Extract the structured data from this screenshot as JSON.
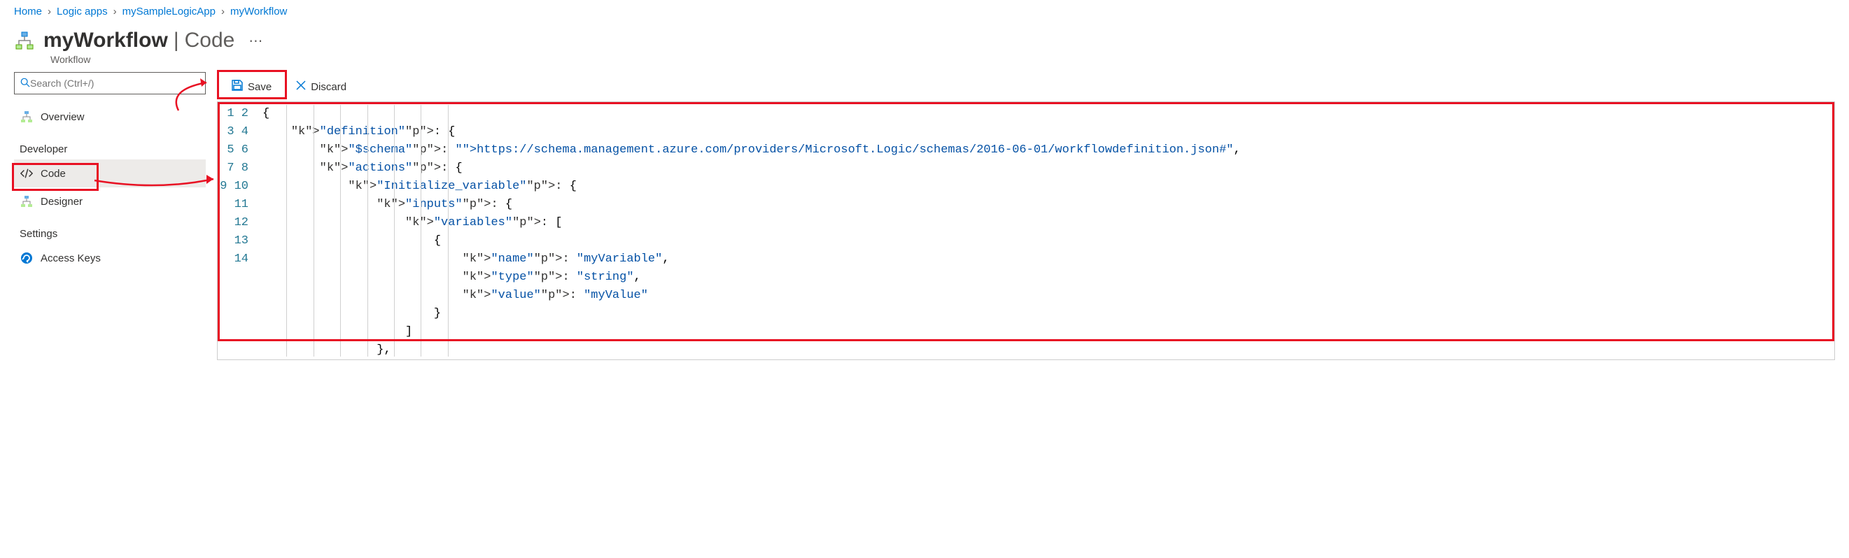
{
  "breadcrumb": [
    {
      "label": "Home"
    },
    {
      "label": "Logic apps"
    },
    {
      "label": "mySampleLogicApp"
    },
    {
      "label": "myWorkflow"
    }
  ],
  "header": {
    "title": "myWorkflow",
    "section": "Code",
    "subtitle": "Workflow"
  },
  "sidebar": {
    "search_placeholder": "Search (Ctrl+/)",
    "overview_label": "Overview",
    "developer_label": "Developer",
    "code_label": "Code",
    "designer_label": "Designer",
    "settings_label": "Settings",
    "access_keys_label": "Access Keys"
  },
  "toolbar": {
    "save_label": "Save",
    "discard_label": "Discard"
  },
  "editor": {
    "line_count": 14,
    "schema_url": "https://schema.management.azure.com/providers/Microsoft.Logic/schemas/2016-06-01/workflowdefinition.json#",
    "json": {
      "definition": {
        "$schema": "https://schema.management.azure.com/providers/Microsoft.Logic/schemas/2016-06-01/workflowdefinition.json#",
        "actions": {
          "Initialize_variable": {
            "inputs": {
              "variables": [
                {
                  "name": "myVariable",
                  "type": "string",
                  "value": "myValue"
                }
              ]
            }
          }
        }
      }
    },
    "lines": [
      "{",
      "    \"definition\": {",
      "        \"$schema\": \"https://schema.management.azure.com/providers/Microsoft.Logic/schemas/2016-06-01/workflowdefinition.json#\",",
      "        \"actions\": {",
      "            \"Initialize_variable\": {",
      "                \"inputs\": {",
      "                    \"variables\": [",
      "                        {",
      "                            \"name\": \"myVariable\",",
      "                            \"type\": \"string\",",
      "                            \"value\": \"myValue\"",
      "                        }",
      "                    ]",
      "                },"
    ]
  }
}
